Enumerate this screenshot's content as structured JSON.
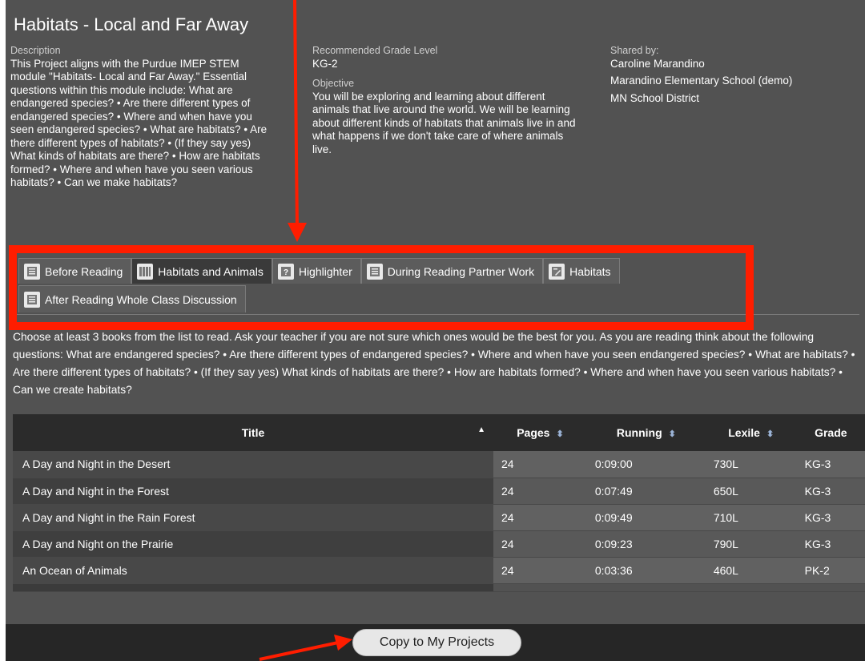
{
  "page_title": "Habitats - Local and Far Away",
  "description": {
    "label": "Description",
    "text": "This Project aligns with the Purdue IMEP STEM module \"Habitats- Local and Far Away.\" Essential questions within this module include: What are endangered species? • Are there different types of endangered species? • Where and when have you seen endangered species? • What are habitats? • Are there different types of habitats? • (If they say yes) What kinds of habitats are there? • How are habitats formed? • Where and when have you seen various habitats? • Can we make habitats?"
  },
  "grade_level": {
    "label": "Recommended Grade Level",
    "value": "KG-2"
  },
  "objective": {
    "label": "Objective",
    "text": "You will be exploring and learning about different animals that live around the world. We will be learning about different kinds of habitats that animals live in and what happens if we don't take care of where animals live."
  },
  "shared_by": {
    "label": "Shared by:",
    "name": "Caroline Marandino",
    "school": "Marandino Elementary School (demo)",
    "district": "MN School District"
  },
  "tabs": [
    {
      "label": "Before Reading",
      "icon": "document-icon"
    },
    {
      "label": "Habitats and Animals",
      "icon": "books-icon"
    },
    {
      "label": "Highlighter",
      "icon": "question-icon"
    },
    {
      "label": "During Reading Partner Work",
      "icon": "document-icon"
    },
    {
      "label": "Habitats",
      "icon": "edit-icon"
    },
    {
      "label": "After Reading Whole Class Discussion",
      "icon": "document-icon"
    }
  ],
  "intro_text": "Choose at least 3 books from the list to read. Ask your teacher if you are not sure which ones would be the best for you. As you are reading think about the following questions: What are endangered species? • Are there different types of endangered species? • Where and when have you seen endangered species? • What are habitats? • Are there different types of habitats? • (If they say yes) What kinds of habitats are there? • How are habitats formed? • Where and when have you seen various habitats? • Can we create habitats?",
  "table": {
    "columns": [
      "Title",
      "Pages",
      "Running",
      "Lexile",
      "Grade"
    ],
    "rows": [
      [
        "A Day and Night in the Desert",
        "24",
        "0:09:00",
        "730L",
        "KG-3"
      ],
      [
        "A Day and Night in the Forest",
        "24",
        "0:07:49",
        "650L",
        "KG-3"
      ],
      [
        "A Day and Night in the Rain Forest",
        "24",
        "0:09:49",
        "710L",
        "KG-3"
      ],
      [
        "A Day and Night on the Prairie",
        "24",
        "0:09:23",
        "790L",
        "KG-3"
      ],
      [
        "An Ocean of Animals",
        "24",
        "0:03:36",
        "460L",
        "PK-2"
      ]
    ]
  },
  "copy_button": "Copy to My Projects",
  "colors": {
    "annotation_red": "#ff1d00",
    "panel": "#525252",
    "header": "#2b2b2b"
  }
}
